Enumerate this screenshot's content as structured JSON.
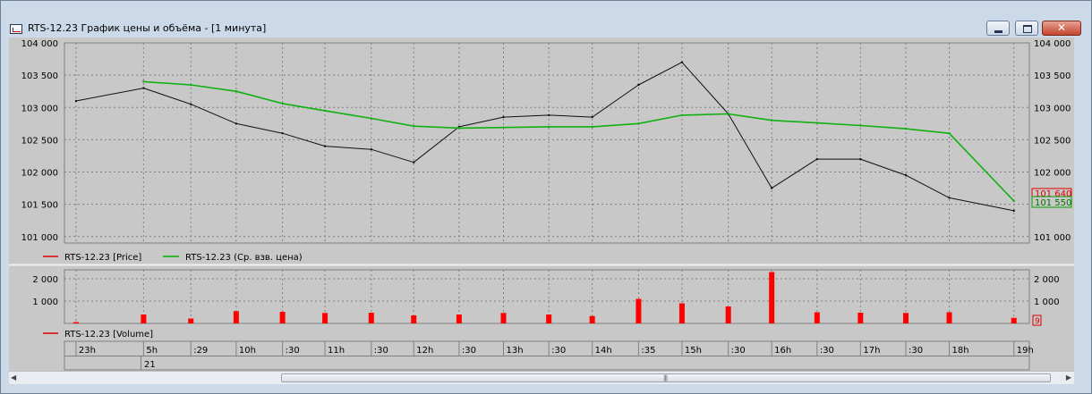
{
  "window": {
    "title": "RTS-12.23 График цены и объёма - [1 минута]",
    "close_label": "✕"
  },
  "price_panel": {
    "y_ticks": [
      "104 000",
      "103 500",
      "103 000",
      "102 500",
      "102 000",
      "101 500",
      "101 000"
    ],
    "y_tick_values": [
      104000,
      103500,
      103000,
      102500,
      102000,
      101500,
      101000
    ],
    "last_price_label": "101 640",
    "last_vwap_label": "101 550",
    "legend": [
      {
        "name": "RTS-12.23 [Price]",
        "color": "#e00000"
      },
      {
        "name": "RTS-12.23 (Ср. взв. цена)",
        "color": "#00b000"
      }
    ]
  },
  "volume_panel": {
    "y_ticks": [
      "2 000",
      "1 000"
    ],
    "y_tick_values": [
      2000,
      1000
    ],
    "last_volume_label": "9",
    "legend": [
      {
        "name": "RTS-12.23 [Volume]",
        "color": "#e00000"
      }
    ]
  },
  "time_axis": {
    "labels": [
      "23h",
      "5h",
      ":29",
      "10h",
      ":30",
      "11h",
      ":30",
      "12h",
      ":30",
      "13h",
      ":30",
      "14h",
      ":35",
      "15h",
      ":30",
      "16h",
      ":30",
      "17h",
      ":30",
      "18h",
      "19h"
    ],
    "date_label": "21"
  },
  "colors": {
    "price": "#101010",
    "vwap": "#10b010",
    "volume": "#ff0000",
    "background": "#c8c8c8",
    "grid": "#808080"
  },
  "chart_data": [
    {
      "type": "line",
      "x": [
        "23h",
        "5h",
        ":29",
        "10h",
        ":30",
        "11h",
        ":30",
        "12h",
        ":30",
        "13h",
        ":30",
        "14h",
        ":35",
        "15h",
        ":30",
        "16h",
        ":30",
        "17h",
        ":30",
        "18h",
        "19h"
      ],
      "ylim": [
        100900,
        104000
      ],
      "series": [
        {
          "name": "RTS-12.23 [Price]",
          "values": [
            103100,
            103300,
            103050,
            102750,
            102600,
            102400,
            102350,
            102150,
            102700,
            102850,
            102880,
            102850,
            103350,
            103700,
            102900,
            101750,
            102200,
            102200,
            101950,
            101600,
            101400
          ]
        },
        {
          "name": "RTS-12.23 (Ср. взв. цена)",
          "values": [
            null,
            103400,
            103350,
            103250,
            103060,
            102950,
            102830,
            102710,
            102680,
            102690,
            102700,
            102700,
            102750,
            102880,
            102900,
            102800,
            102760,
            102720,
            102670,
            102600,
            101550
          ]
        }
      ]
    },
    {
      "type": "bar",
      "x": [
        "23h",
        "5h",
        ":29",
        "10h",
        ":30",
        "11h",
        ":30",
        "12h",
        ":30",
        "13h",
        ":30",
        "14h",
        ":35",
        "15h",
        ":30",
        "16h",
        ":30",
        "17h",
        ":30",
        "18h",
        "19h"
      ],
      "ylim": [
        0,
        2400
      ],
      "series": [
        {
          "name": "RTS-12.23 [Volume]",
          "values": [
            60,
            400,
            220,
            550,
            520,
            470,
            480,
            360,
            400,
            470,
            400,
            330,
            1100,
            900,
            760,
            2300,
            500,
            480,
            470,
            500,
            250
          ]
        }
      ]
    }
  ]
}
